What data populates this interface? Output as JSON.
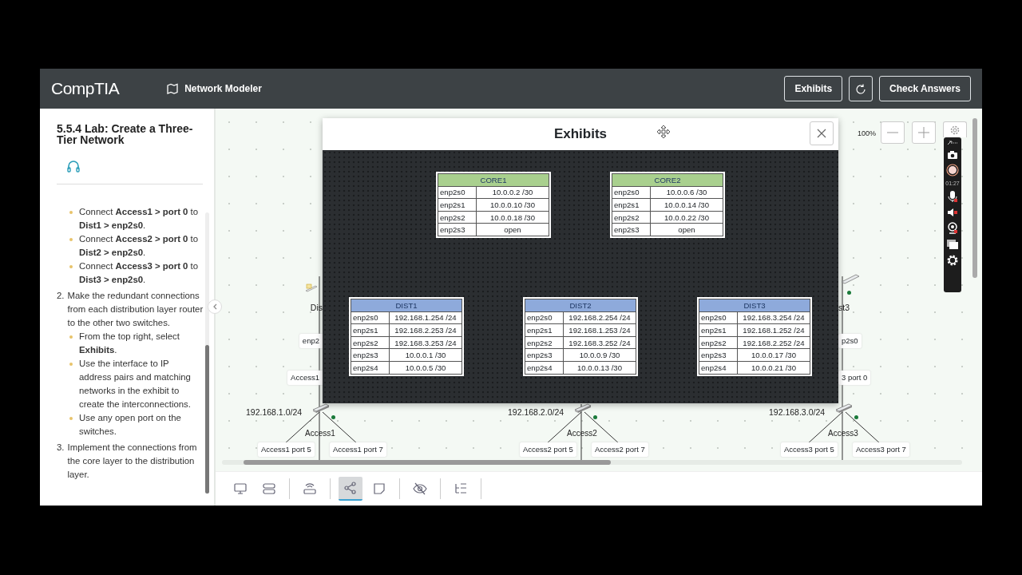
{
  "header": {
    "logo": "CompTIA",
    "module": "Network Modeler",
    "buttons": [
      "Exhibits",
      "Check Answers"
    ]
  },
  "lab": {
    "title": "5.5.4 Lab: Create a Three-Tier Network",
    "steps": [
      {
        "bullets": [
          "Connect **Access1 > port 0** to **Dist1 > enp2s0**.",
          "Connect **Access2 > port 0** to **Dist2 > enp2s0**.",
          "Connect **Access3 > port 0** to **Dist3 > enp2s0**."
        ]
      },
      {
        "number": "2.",
        "text": "Make the redundant connections from each distribution layer router to the other two switches.",
        "bullets": [
          "From the top right, select **Exhibits**.",
          "Use the interface to IP address pairs and matching networks in the exhibit to create the interconnections.",
          "Use any open port on the switches."
        ]
      },
      {
        "number": "3.",
        "text": "Implement the connections from the core layer to the distribution layer."
      }
    ]
  },
  "canvas": {
    "zoom": "100%",
    "partial_labels": [
      {
        "router": "Dis",
        "link": "enp2",
        "port": "Access1"
      },
      {
        "router": "st3",
        "link": "p2s0",
        "port": "3 port 0"
      }
    ],
    "networks": [
      {
        "subnet": "192.168.1.0/24",
        "switch": "Access1",
        "ports": [
          "Access1 port 5",
          "Access1 port 7"
        ]
      },
      {
        "subnet": "192.168.2.0/24",
        "switch": "Access2",
        "ports": [
          "Access2 port 5",
          "Access2 port 7"
        ]
      },
      {
        "subnet": "192.168.3.0/24",
        "switch": "Access3",
        "ports": [
          "Access3 port 5",
          "Access3 port 7"
        ]
      }
    ]
  },
  "exhibit": {
    "title": "Exhibits",
    "tiers": [
      {
        "tables": [
          {
            "name": "CORE1",
            "color": "#a9d08e",
            "rows": [
              [
                "enp2s0",
                "10.0.0.2 /30"
              ],
              [
                "enp2s1",
                "10.0.0.10 /30"
              ],
              [
                "enp2s2",
                "10.0.0.18 /30"
              ],
              [
                "enp2s3",
                "open"
              ]
            ]
          },
          {
            "name": "CORE2",
            "color": "#a9d08e",
            "rows": [
              [
                "enp2s0",
                "10.0.0.6 /30"
              ],
              [
                "enp2s1",
                "10.0.0.14 /30"
              ],
              [
                "enp2s2",
                "10.0.0.22 /30"
              ],
              [
                "enp2s3",
                "open"
              ]
            ]
          }
        ]
      },
      {
        "tables": [
          {
            "name": "DIST1",
            "color": "#8eaadb",
            "rows": [
              [
                "enp2s0",
                "192.168.1.254 /24"
              ],
              [
                "enp2s1",
                "192.168.2.253 /24"
              ],
              [
                "enp2s2",
                "192.168.3.253 /24"
              ],
              [
                "enp2s3",
                "10.0.0.1 /30"
              ],
              [
                "enp2s4",
                "10.0.0.5 /30"
              ]
            ]
          },
          {
            "name": "DIST2",
            "color": "#8eaadb",
            "rows": [
              [
                "enp2s0",
                "192.168.2.254 /24"
              ],
              [
                "enp2s1",
                "192.168.1.253 /24"
              ],
              [
                "enp2s2",
                "192.168.3.252 /24"
              ],
              [
                "enp2s3",
                "10.0.0.9 /30"
              ],
              [
                "enp2s4",
                "10.0.0.13 /30"
              ]
            ]
          },
          {
            "name": "DIST3",
            "color": "#8eaadb",
            "rows": [
              [
                "enp2s0",
                "192.168.3.254 /24"
              ],
              [
                "enp2s1",
                "192.168.1.252 /24"
              ],
              [
                "enp2s2",
                "192.168.2.252 /24"
              ],
              [
                "enp2s3",
                "10.0.0.17 /30"
              ],
              [
                "enp2s4",
                "10.0.0.21 /30"
              ]
            ]
          }
        ]
      }
    ]
  },
  "recorder": {
    "time": "01:27"
  },
  "tools": [
    {
      "kind": "monitor",
      "selected": false
    },
    {
      "kind": "server",
      "selected": false
    },
    {
      "kind": "router",
      "selected": false
    },
    {
      "kind": "topology",
      "selected": true
    },
    {
      "kind": "note",
      "selected": false
    },
    {
      "kind": "hide",
      "selected": false
    },
    {
      "kind": "tree",
      "selected": false
    }
  ]
}
